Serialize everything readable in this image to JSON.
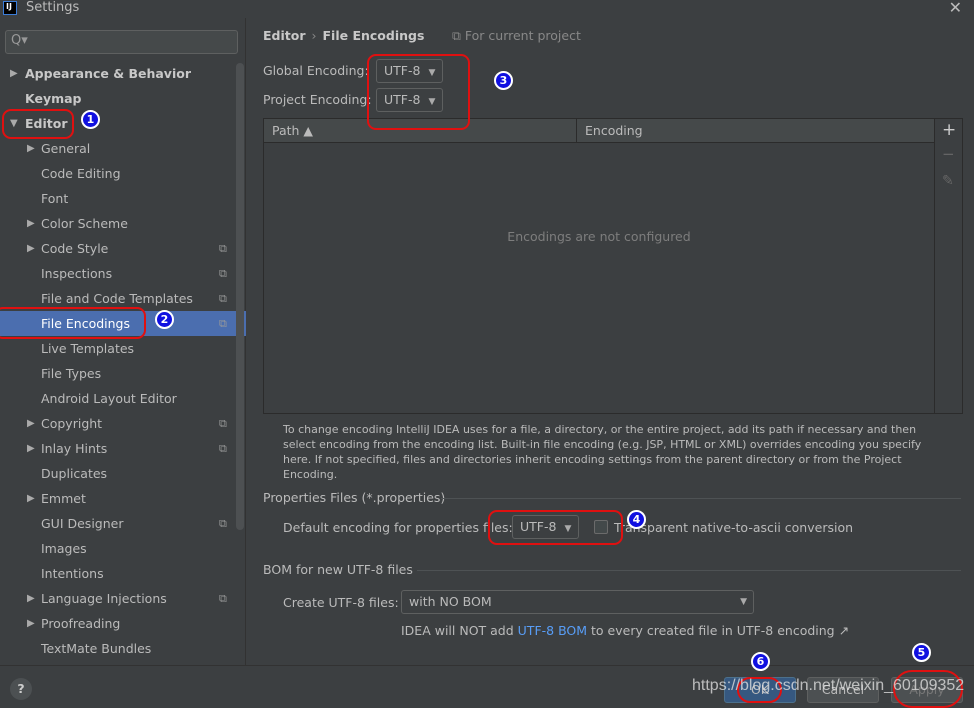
{
  "window": {
    "title": "Settings",
    "logo": "IJ",
    "close": "✕"
  },
  "sidebar": {
    "search_placeholder": "",
    "search_icon": "Q▾",
    "items": [
      {
        "label": "Appearance & Behavior",
        "arrow": "▶",
        "bold": true,
        "level": 0
      },
      {
        "label": "Keymap",
        "arrow": "",
        "bold": true,
        "level": 0
      },
      {
        "label": "Editor",
        "arrow": "▼",
        "bold": true,
        "level": 0
      },
      {
        "label": "General",
        "arrow": "▶",
        "level": 1
      },
      {
        "label": "Code Editing",
        "arrow": "",
        "level": 1
      },
      {
        "label": "Font",
        "arrow": "",
        "level": 1
      },
      {
        "label": "Color Scheme",
        "arrow": "▶",
        "level": 1
      },
      {
        "label": "Code Style",
        "arrow": "▶",
        "level": 1,
        "copy": true
      },
      {
        "label": "Inspections",
        "arrow": "",
        "level": 1,
        "copy": true
      },
      {
        "label": "File and Code Templates",
        "arrow": "",
        "level": 1,
        "copy": true
      },
      {
        "label": "File Encodings",
        "arrow": "",
        "level": 1,
        "copy": true,
        "selected": true
      },
      {
        "label": "Live Templates",
        "arrow": "",
        "level": 1
      },
      {
        "label": "File Types",
        "arrow": "",
        "level": 1
      },
      {
        "label": "Android Layout Editor",
        "arrow": "",
        "level": 1
      },
      {
        "label": "Copyright",
        "arrow": "▶",
        "level": 1,
        "copy": true
      },
      {
        "label": "Inlay Hints",
        "arrow": "▶",
        "level": 1,
        "copy": true
      },
      {
        "label": "Duplicates",
        "arrow": "",
        "level": 1
      },
      {
        "label": "Emmet",
        "arrow": "▶",
        "level": 1
      },
      {
        "label": "GUI Designer",
        "arrow": "",
        "level": 1,
        "copy": true
      },
      {
        "label": "Images",
        "arrow": "",
        "level": 1
      },
      {
        "label": "Intentions",
        "arrow": "",
        "level": 1
      },
      {
        "label": "Language Injections",
        "arrow": "▶",
        "level": 1,
        "copy": true
      },
      {
        "label": "Proofreading",
        "arrow": "▶",
        "level": 1
      },
      {
        "label": "TextMate Bundles",
        "arrow": "",
        "level": 1
      }
    ]
  },
  "main": {
    "breadcrumb": {
      "parent": "Editor",
      "sep": "›",
      "current": "File Encodings"
    },
    "scope": "⧉ For current project",
    "global_encoding": {
      "label": "Global Encoding:",
      "value": "UTF-8"
    },
    "project_encoding": {
      "label": "Project Encoding:",
      "value": "UTF-8"
    },
    "table": {
      "col_path": "Path ▲",
      "col_encoding": "Encoding",
      "empty": "Encodings are not configured",
      "add": "+",
      "remove": "−",
      "edit": "✎"
    },
    "description": "To change encoding IntelliJ IDEA uses for a file, a directory, or the entire project, add its path if necessary and then select encoding from the encoding list. Built-in file encoding (e.g. JSP, HTML or XML) overrides encoding you specify here. If not specified, files and directories inherit encoding settings from the parent directory or from the Project Encoding.",
    "properties": {
      "title": "Properties Files (*.properties)",
      "default_label": "Default encoding for properties files:",
      "default_value": "UTF-8",
      "transparent_label": "Transparent native-to-ascii conversion",
      "transparent_checked": false
    },
    "bom": {
      "title": "BOM for new UTF-8 files",
      "create_label": "Create UTF-8 files:",
      "create_value": "with NO BOM",
      "note_pre": "IDEA will NOT add ",
      "note_link": "UTF-8 BOM",
      "note_post": " to every created file in UTF-8 encoding ↗"
    }
  },
  "footer": {
    "help": "?",
    "ok": "OK",
    "cancel": "Cancel",
    "apply": "Apply"
  },
  "annotations": [
    "1",
    "2",
    "3",
    "4",
    "5",
    "6"
  ],
  "watermark": "https://blog.csdn.net/weixin_60109352",
  "colors": {
    "background": "#3c3f41",
    "selection": "#4b6eaf",
    "annotation": "#e01010",
    "link": "#589df6"
  }
}
